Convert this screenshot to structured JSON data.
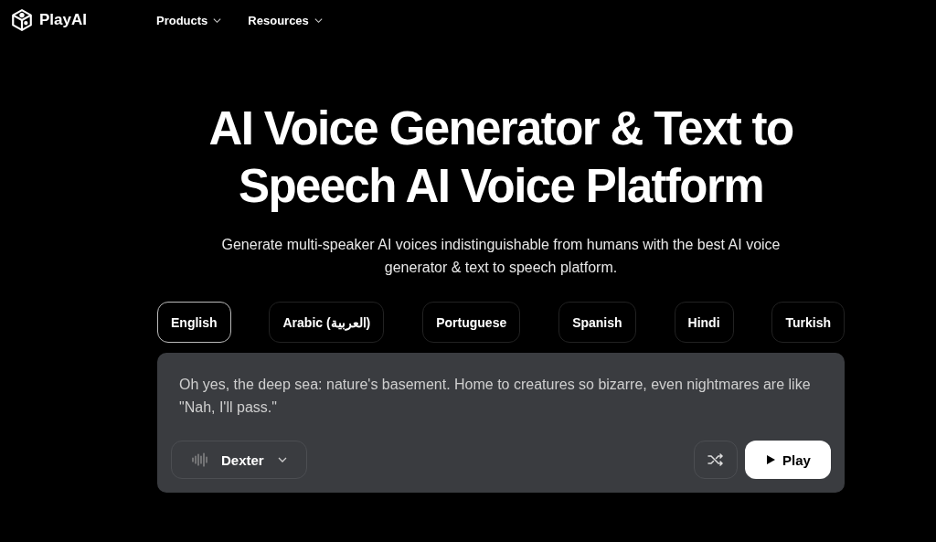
{
  "nav": {
    "logo": "PlayAI",
    "items": [
      {
        "label": "Products"
      },
      {
        "label": "Resources"
      }
    ]
  },
  "hero": {
    "title_lines": [
      "AI Voice Generator & Text to",
      "Speech AI Voice Platform"
    ],
    "subtitle": "Generate multi-speaker AI voices indistinguishable from humans with the best AI voice generator & text to speech platform."
  },
  "languages": [
    {
      "label": "English",
      "selected": true
    },
    {
      "label": "Arabic (العربية)",
      "selected": false
    },
    {
      "label": "Portuguese",
      "selected": false
    },
    {
      "label": "Spanish",
      "selected": false
    },
    {
      "label": "Hindi",
      "selected": false
    },
    {
      "label": "Turkish",
      "selected": false
    }
  ],
  "sample": {
    "text": "Oh yes, the deep sea: nature's basement. Home to creatures so bizarre, even nightmares are like \"Nah, I'll pass.\"",
    "voice": "Dexter",
    "play": "Play"
  }
}
